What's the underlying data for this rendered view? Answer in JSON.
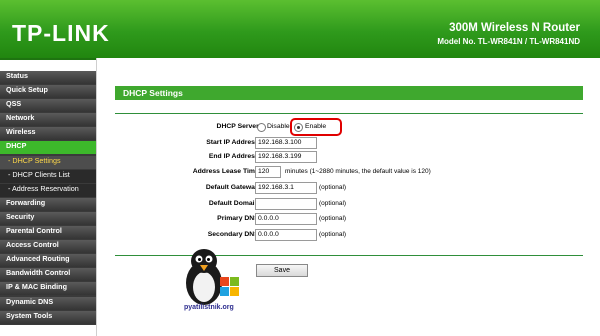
{
  "header": {
    "logo": "TP-LINK",
    "model_title": "300M Wireless N Router",
    "model_number": "Model No. TL-WR841N / TL-WR841ND"
  },
  "sidebar": {
    "items": [
      {
        "label": "Status"
      },
      {
        "label": "Quick Setup"
      },
      {
        "label": "QSS"
      },
      {
        "label": "Network"
      },
      {
        "label": "Wireless"
      },
      {
        "label": "DHCP"
      },
      {
        "label": "- DHCP Settings"
      },
      {
        "label": "- DHCP Clients List"
      },
      {
        "label": "- Address Reservation"
      },
      {
        "label": "Forwarding"
      },
      {
        "label": "Security"
      },
      {
        "label": "Parental Control"
      },
      {
        "label": "Access Control"
      },
      {
        "label": "Advanced Routing"
      },
      {
        "label": "Bandwidth Control"
      },
      {
        "label": "IP & MAC Binding"
      },
      {
        "label": "Dynamic DNS"
      },
      {
        "label": "System Tools"
      }
    ]
  },
  "main": {
    "section_title": "DHCP Settings",
    "dhcp_server": {
      "label": "DHCP Server:",
      "disable": "Disable",
      "enable": "Enable"
    },
    "start_ip": {
      "label": "Start IP Address:",
      "value": "192.168.3.100"
    },
    "end_ip": {
      "label": "End IP Address:",
      "value": "192.168.3.199"
    },
    "lease_time": {
      "label": "Address Lease Time:",
      "value": "120",
      "hint": "minutes (1~2880 minutes, the default value is 120)"
    },
    "gateway": {
      "label": "Default Gateway:",
      "value": "192.168.3.1",
      "hint": "(optional)"
    },
    "domain": {
      "label": "Default Domain:",
      "value": "",
      "hint": "(optional)"
    },
    "primary_dns": {
      "label": "Primary DNS:",
      "value": "0.0.0.0",
      "hint": "(optional)"
    },
    "secondary_dns": {
      "label": "Secondary DNS:",
      "value": "0.0.0.0",
      "hint": "(optional)"
    },
    "save_label": "Save"
  },
  "watermark": "pyatilistnik.org",
  "colors": {
    "brand_green": "#2f9a1c",
    "highlight_red": "#e00000"
  }
}
